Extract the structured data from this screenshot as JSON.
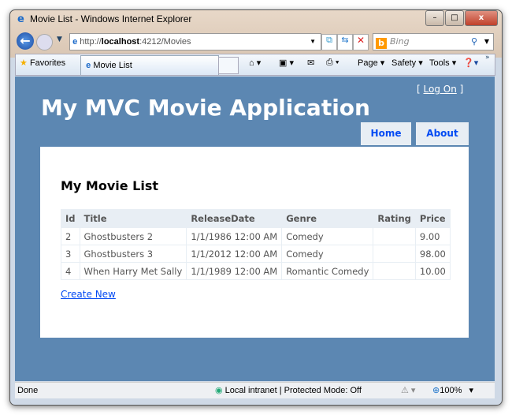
{
  "window": {
    "title": "Movie List - Windows Internet Explorer"
  },
  "address": {
    "url_prefix": "http://",
    "url_host": "localhost",
    "url_rest": ":4212/Movies",
    "search_placeholder": "Bing"
  },
  "toolbar": {
    "favorites": "Favorites",
    "tab": "Movie List",
    "page": "Page",
    "safety": "Safety",
    "tools": "Tools"
  },
  "site": {
    "title": "My MVC Movie Application",
    "logon": "Log On",
    "menu": [
      "Home",
      "About"
    ]
  },
  "main": {
    "heading": "My Movie List",
    "create_new": "Create New",
    "columns": [
      "Id",
      "Title",
      "ReleaseDate",
      "Genre",
      "Rating",
      "Price"
    ],
    "rows": [
      [
        "2",
        "Ghostbusters 2",
        "1/1/1986 12:00 AM",
        "Comedy",
        "",
        "9.00"
      ],
      [
        "3",
        "Ghostbusters 3",
        "1/1/2012 12:00 AM",
        "Comedy",
        "",
        "98.00"
      ],
      [
        "4",
        "When Harry Met Sally",
        "1/1/1989 12:00 AM",
        "Romantic Comedy",
        "",
        "10.00"
      ]
    ]
  },
  "status": {
    "text": "Done",
    "zone": "Local intranet | Protected Mode: Off",
    "zoom": "100%"
  }
}
